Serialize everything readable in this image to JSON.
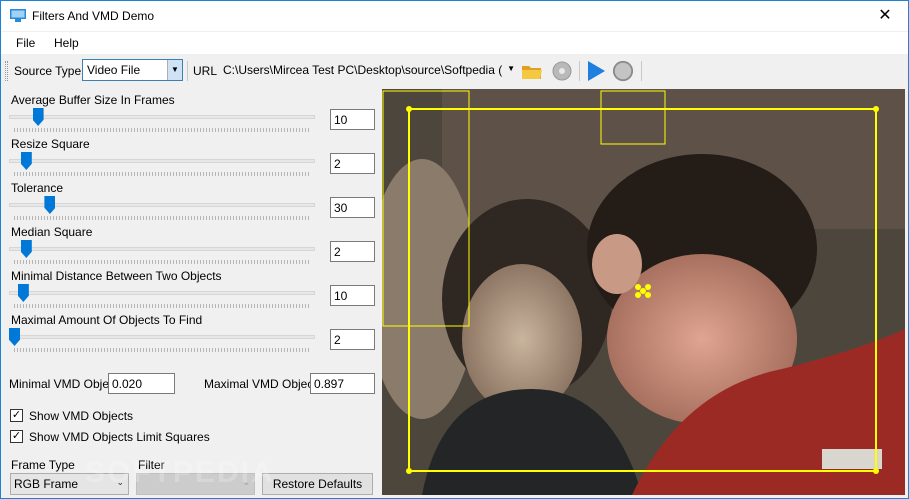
{
  "window": {
    "title": "Filters And VMD Demo",
    "close_glyph": "✕"
  },
  "menu": {
    "file": "File",
    "help": "Help"
  },
  "toolbar": {
    "source_type_label": "Source Type",
    "source_type_value": "Video File",
    "url_label": "URL",
    "url_value": "C:\\Users\\Mircea Test PC\\Desktop\\source\\Softpedia (",
    "icons": [
      "folder-open-icon",
      "disc-icon",
      "play-icon",
      "stop-icon"
    ]
  },
  "sliders": [
    {
      "label": "Average Buffer Size In Frames",
      "value": "10",
      "level": 0.08
    },
    {
      "label": "Resize Square",
      "value": "2",
      "level": 0.04
    },
    {
      "label": "Tolerance",
      "value": "30",
      "level": 0.12
    },
    {
      "label": "Median Square",
      "value": "2",
      "level": 0.04
    },
    {
      "label": "Minimal Distance Between Two Objects",
      "value": "10",
      "level": 0.03
    },
    {
      "label": "Maximal Amount Of Objects To Find",
      "value": "2",
      "level": 0.0
    }
  ],
  "vmd": {
    "min_label": "Minimal VMD Object",
    "min_value": "0.020",
    "max_label": "Maximal VMD Object",
    "max_value": "0.897"
  },
  "checkboxes": [
    {
      "label": "Show VMD Objects",
      "checked": true
    },
    {
      "label": "Show VMD Objects Limit Squares",
      "checked": true
    }
  ],
  "frame_type": {
    "label": "Frame Type",
    "value": "RGB Frame"
  },
  "filter": {
    "label": "Filter",
    "value": ""
  },
  "restore_button": "Restore Defaults",
  "watermark": "SOFTPEDIA",
  "colors": {
    "accent": "#0078d7",
    "detection": "#ffff00",
    "border": "#1883d7"
  }
}
